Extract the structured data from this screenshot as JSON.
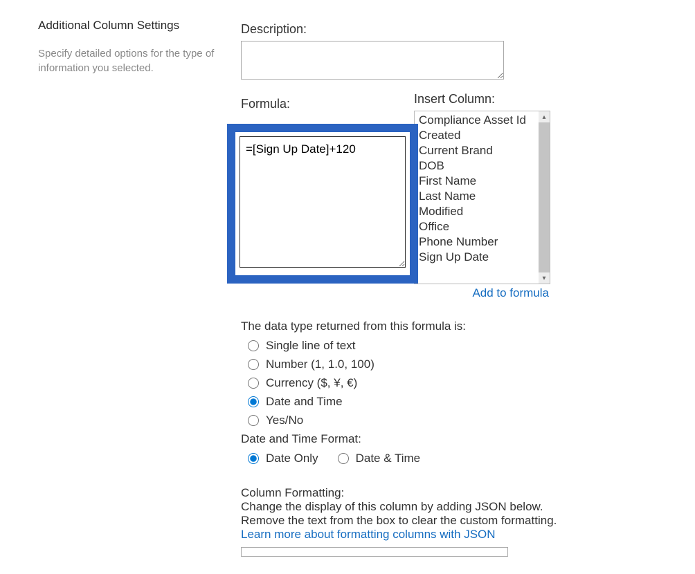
{
  "leftPanel": {
    "title": "Additional Column Settings",
    "description": "Specify detailed options for the type of information you selected."
  },
  "description": {
    "label": "Description:",
    "value": ""
  },
  "formula": {
    "label": "Formula:",
    "value": "=[Sign Up Date]+120"
  },
  "insertColumn": {
    "label": "Insert Column:",
    "items": [
      "Compliance Asset Id",
      "Created",
      "Current Brand",
      "DOB",
      "First Name",
      "Last Name",
      "Modified",
      "Office",
      "Phone Number",
      "Sign Up Date"
    ]
  },
  "addToFormula": "Add to formula",
  "dataTypeReturned": {
    "label": "The data type returned from this formula is:",
    "options": {
      "text": "Single line of text",
      "number": "Number (1, 1.0, 100)",
      "currency": "Currency ($, ¥, €)",
      "datetime": "Date and Time",
      "yesno": "Yes/No"
    },
    "selected": "datetime"
  },
  "dateTimeFormat": {
    "label": "Date and Time Format:",
    "options": {
      "dateonly": "Date Only",
      "datetime": "Date & Time"
    },
    "selected": "dateonly"
  },
  "columnFormatting": {
    "label": "Column Formatting:",
    "line1": "Change the display of this column by adding JSON below.",
    "line2": "Remove the text from the box to clear the custom formatting.",
    "link": "Learn more about formatting columns with JSON"
  }
}
